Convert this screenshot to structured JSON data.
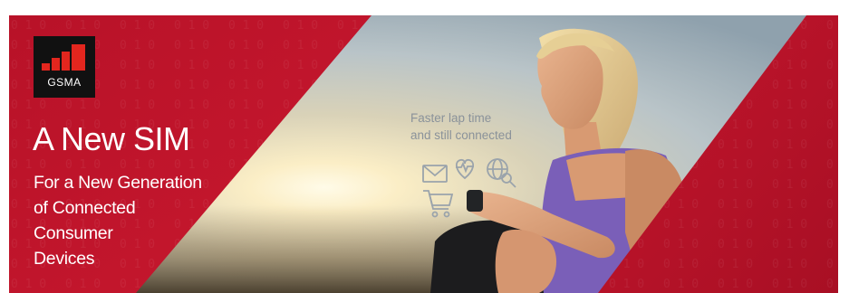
{
  "logo": {
    "text": "GSMA"
  },
  "headline": "A New SIM",
  "subheadline_lines": [
    "For a New Generation",
    "of Connected",
    "Consumer",
    "Devices"
  ],
  "photo_caption_lines": [
    "Faster lap time",
    "and still connected"
  ],
  "icons": [
    "mail-icon",
    "heart-rate-icon",
    "globe-search-icon",
    "shopping-cart-icon"
  ],
  "colors": {
    "brand_red": "#c0152f",
    "dark_red": "#9a0f22",
    "logo_background": "#111111",
    "logo_bars": "#e3261e",
    "text_white": "#ffffff",
    "caption_gray": "#8a929a"
  }
}
